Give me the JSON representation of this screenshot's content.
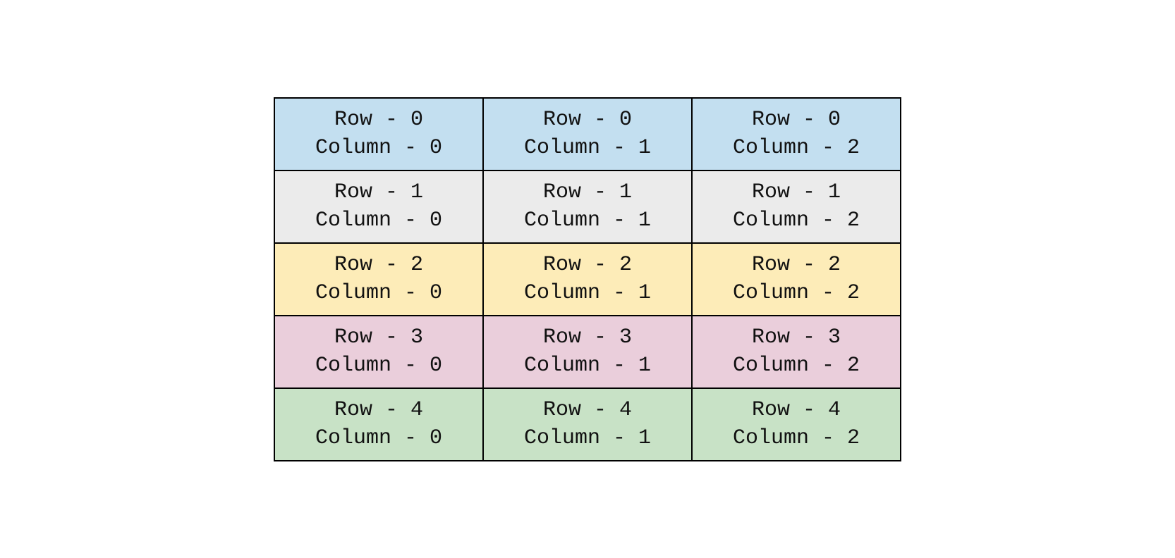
{
  "table": {
    "rows": [
      {
        "color": "#c3dff0",
        "cells": [
          "Row - 0\nColumn - 0",
          "Row - 0\nColumn - 1",
          "Row - 0\nColumn - 2"
        ]
      },
      {
        "color": "#ebebeb",
        "cells": [
          "Row - 1\nColumn - 0",
          "Row - 1\nColumn - 1",
          "Row - 1\nColumn - 2"
        ]
      },
      {
        "color": "#fdecb8",
        "cells": [
          "Row - 2\nColumn - 0",
          "Row - 2\nColumn - 1",
          "Row - 2\nColumn - 2"
        ]
      },
      {
        "color": "#eacedb",
        "cells": [
          "Row - 3\nColumn - 0",
          "Row - 3\nColumn - 1",
          "Row - 3\nColumn - 2"
        ]
      },
      {
        "color": "#c8e2c6",
        "cells": [
          "Row - 4\nColumn - 0",
          "Row - 4\nColumn - 1",
          "Row - 4\nColumn - 2"
        ]
      }
    ]
  }
}
